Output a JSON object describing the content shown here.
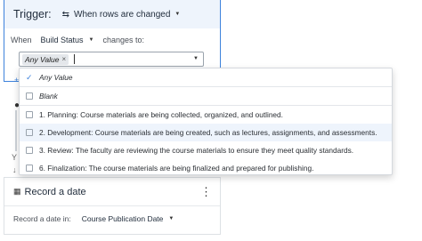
{
  "trigger": {
    "title": "Trigger:",
    "event_icon": "rows-changed-icon",
    "event_label": "When rows are changed"
  },
  "condition": {
    "prefix": "When",
    "field": "Build Status",
    "suffix": "changes to:",
    "selected_chip": "Any Value",
    "chip_remove": "×"
  },
  "dropdown": {
    "options": [
      {
        "label": "Any Value",
        "checked": true
      },
      {
        "label": "Blank",
        "checked": false
      },
      {
        "label": "1. Planning: Course materials are being collected, organized, and outlined.",
        "checked": false
      },
      {
        "label": "2. Development: Course materials are being created, such as lectures, assignments, and assessments.",
        "checked": false,
        "highlighted": true
      },
      {
        "label": "3. Review: The faculty are reviewing the course materials to ensure they meet quality standards.",
        "checked": false
      },
      {
        "label": "6. Finalization: The course materials are being finalized and prepared for publishing.",
        "checked": false
      }
    ]
  },
  "action": {
    "icon": "calendar-icon",
    "title": "Record a date",
    "record_label": "Record a date in:",
    "record_field": "Course Publication Date"
  },
  "colors": {
    "accent": "#3d82dc",
    "highlight_row": "#eef4fc"
  }
}
